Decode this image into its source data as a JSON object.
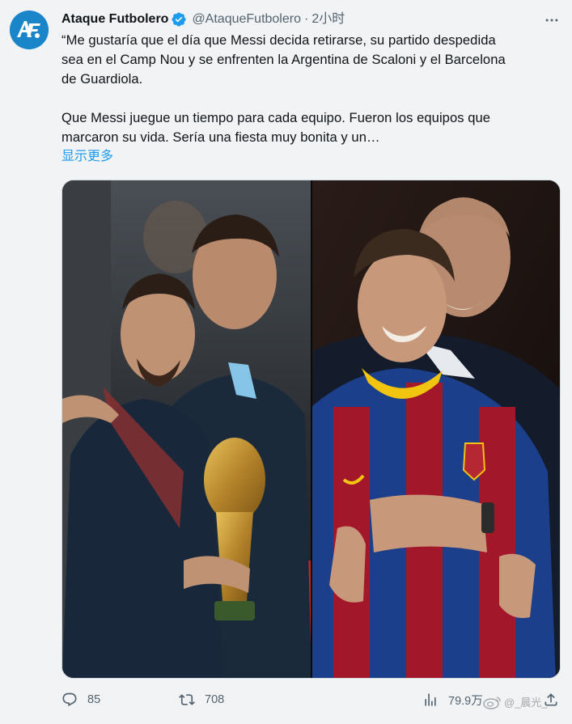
{
  "author": {
    "name": "Ataque Futbolero",
    "handle": "@AtaqueFutbolero",
    "time": "2小时",
    "avatar_icon": "ataque-futbolero-logo",
    "verified_color": "#1d9bf0"
  },
  "tweet": {
    "lines_para1": [
      "“Me gustaría que el día que Messi decida retirarse, su partido despedida",
      "sea en el Camp Nou y se enfrenten la Argentina de Scaloni y el Barcelona",
      "de Guardiola."
    ],
    "lines_para2": [
      "Que Messi juegue un tiempo para cada equipo. Fueron los equipos que",
      "marcaron su vida. Sería una fiesta muy bonita y un…"
    ],
    "show_more": "显示更多"
  },
  "media": {
    "description_icon": "photo-collage-messi-scaloni-guardiola"
  },
  "actions": {
    "replies": "85",
    "retweets": "708",
    "views": "79.9万"
  },
  "watermark": {
    "text": "@_晨光_",
    "icon": "weibo-icon"
  },
  "colors": {
    "accent": "#1d9bf0",
    "muted": "#536471",
    "background": "#f2f3f4"
  }
}
